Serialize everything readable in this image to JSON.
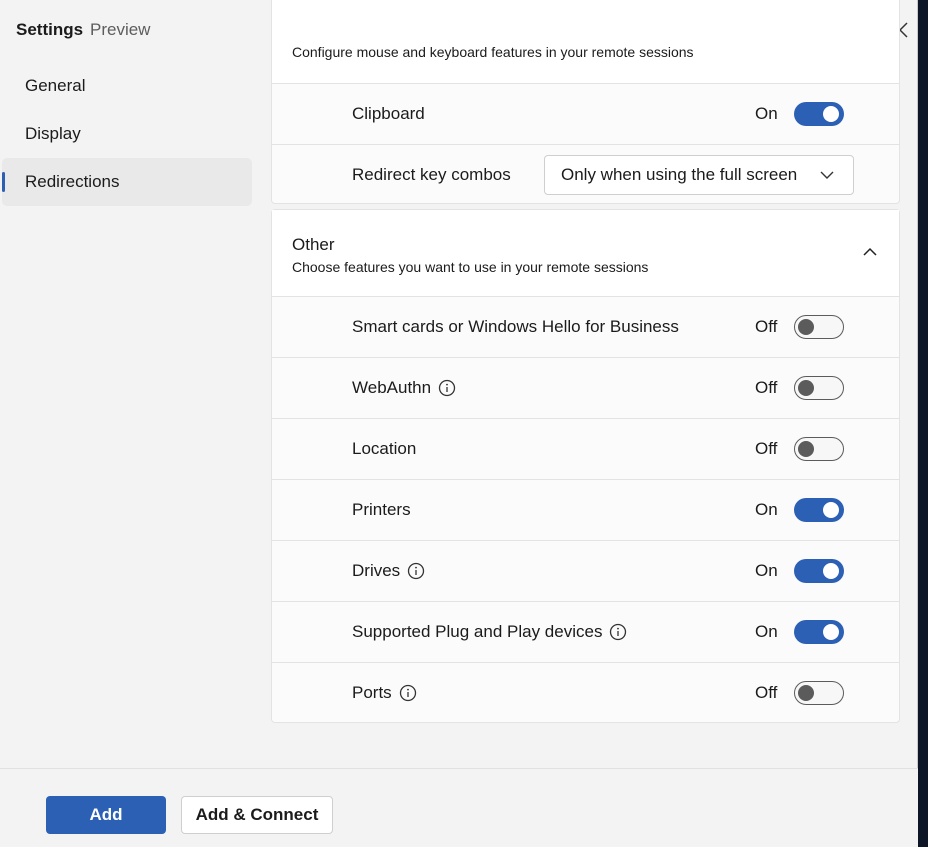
{
  "window": {
    "title": "Settings",
    "subtitle": "Preview"
  },
  "nav": {
    "items": [
      {
        "label": "General",
        "active": false
      },
      {
        "label": "Display",
        "active": false
      },
      {
        "label": "Redirections",
        "active": true
      }
    ]
  },
  "keyboard_section": {
    "description": "Configure mouse and keyboard features in your remote sessions",
    "rows": [
      {
        "label": "Clipboard",
        "state": "On",
        "enabled": true
      },
      {
        "label": "Redirect key combos",
        "dropdown_value": "Only when using the full screen"
      }
    ]
  },
  "other_section": {
    "title": "Other",
    "description": "Choose features you want to use in your remote sessions",
    "rows": [
      {
        "label": "Smart cards or Windows Hello for Business",
        "state": "Off",
        "enabled": false,
        "info": false
      },
      {
        "label": "WebAuthn",
        "state": "Off",
        "enabled": false,
        "info": true
      },
      {
        "label": "Location",
        "state": "Off",
        "enabled": false,
        "info": false
      },
      {
        "label": "Printers",
        "state": "On",
        "enabled": true,
        "info": false
      },
      {
        "label": "Drives",
        "state": "On",
        "enabled": true,
        "info": true
      },
      {
        "label": "Supported Plug and Play devices",
        "state": "On",
        "enabled": true,
        "info": true
      },
      {
        "label": "Ports",
        "state": "Off",
        "enabled": false,
        "info": true
      }
    ]
  },
  "footer": {
    "add_label": "Add",
    "add_connect_label": "Add & Connect"
  },
  "colors": {
    "accent": "#2b60b4",
    "window_bg": "#f3f3f3",
    "card_bg": "#fbfbfb"
  },
  "icons": {
    "close": "close-icon",
    "info": "info-icon",
    "chevron_down": "chevron-down-icon",
    "chevron_up": "chevron-up-icon"
  }
}
